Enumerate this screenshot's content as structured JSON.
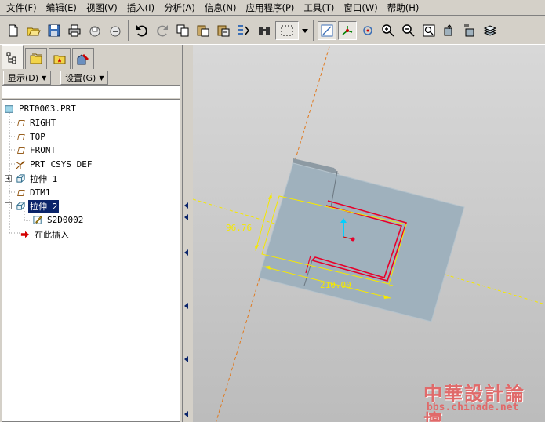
{
  "menu": {
    "items": [
      {
        "label": "文件(F)"
      },
      {
        "label": "编辑(E)"
      },
      {
        "label": "视图(V)"
      },
      {
        "label": "插入(I)"
      },
      {
        "label": "分析(A)"
      },
      {
        "label": "信息(N)"
      },
      {
        "label": "应用程序(P)"
      },
      {
        "label": "工具(T)"
      },
      {
        "label": "窗口(W)"
      },
      {
        "label": "帮助(H)"
      }
    ]
  },
  "toolbar": {
    "icons": [
      "new-icon",
      "open-icon",
      "save-icon",
      "print-icon",
      "mail-icon",
      "link-icon",
      "undo-icon",
      "redo-icon",
      "copy-icon",
      "paste-icon",
      "paste-special-icon",
      "regenerate-icon",
      "find-icon",
      "select-box-icon",
      "dropdown-icon",
      "datum-plane-icon",
      "datum-axis-icon",
      "spin-center-icon",
      "zoom-in-icon",
      "zoom-out-icon",
      "refit-icon",
      "orient-icon",
      "named-view-icon",
      "layers-icon"
    ]
  },
  "panel": {
    "show_label": "显示(D)",
    "settings_label": "设置(G)"
  },
  "tree": {
    "items": [
      {
        "label": "PRT0003.PRT"
      },
      {
        "label": "RIGHT"
      },
      {
        "label": "TOP"
      },
      {
        "label": "FRONT"
      },
      {
        "label": "PRT_CSYS_DEF"
      },
      {
        "label": "拉伸 1"
      },
      {
        "label": "DTM1"
      },
      {
        "label": "拉伸 2"
      },
      {
        "label": "S2D0002"
      },
      {
        "label": "在此插入"
      }
    ]
  },
  "viewport": {
    "dimension_height": "96.76",
    "dimension_width": "210.00",
    "colors": {
      "background": "#c8c8c8",
      "part_face": "#9fb1bd",
      "dimension": "#f5e800",
      "sketch": "#e8002a",
      "datum_axis": "#e07a20"
    }
  },
  "watermark": {
    "title": "中華設計論壇",
    "url": "bbs.chinade.net"
  }
}
